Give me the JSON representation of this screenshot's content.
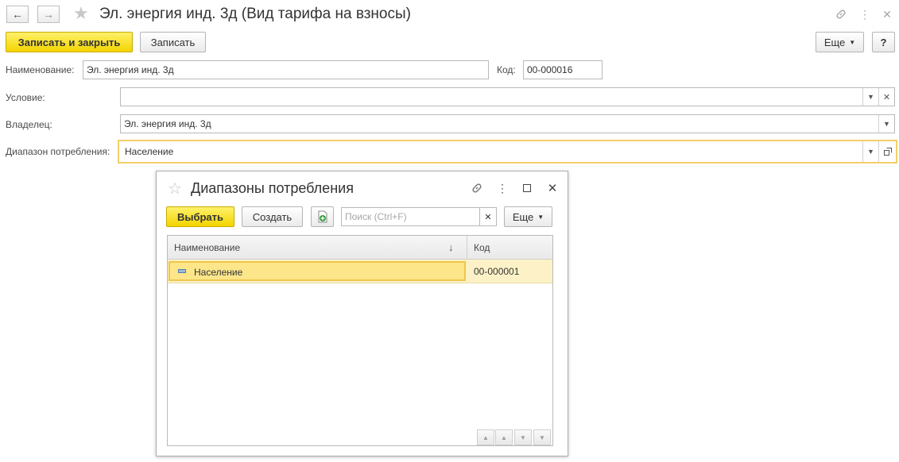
{
  "window": {
    "title": "Эл. энергия инд. 3д (Вид тарифа на взносы)"
  },
  "toolbar": {
    "save_close_label": "Записать и закрыть",
    "save_label": "Записать",
    "more_label": "Еще",
    "help_label": "?"
  },
  "form": {
    "name_label": "Наименование:",
    "name_value": "Эл. энергия инд. 3д",
    "code_label": "Код:",
    "code_value": "00-000016",
    "condition_label": "Условие:",
    "condition_value": "",
    "owner_label": "Владелец:",
    "owner_value": "Эл. энергия инд. 3д",
    "range_label": "Диапазон потребления:",
    "range_value": "Население"
  },
  "popup": {
    "title": "Диапазоны потребления",
    "select_label": "Выбрать",
    "create_label": "Создать",
    "search_placeholder": "Поиск (Ctrl+F)",
    "more_label": "Еще",
    "columns": {
      "name": "Наименование",
      "code": "Код"
    },
    "rows": [
      {
        "name": "Население",
        "code": "00-000001"
      }
    ]
  },
  "colors": {
    "primary_button": "#f2d400",
    "focus_border": "#f3cf6a",
    "selected_row": "#fde68a"
  }
}
